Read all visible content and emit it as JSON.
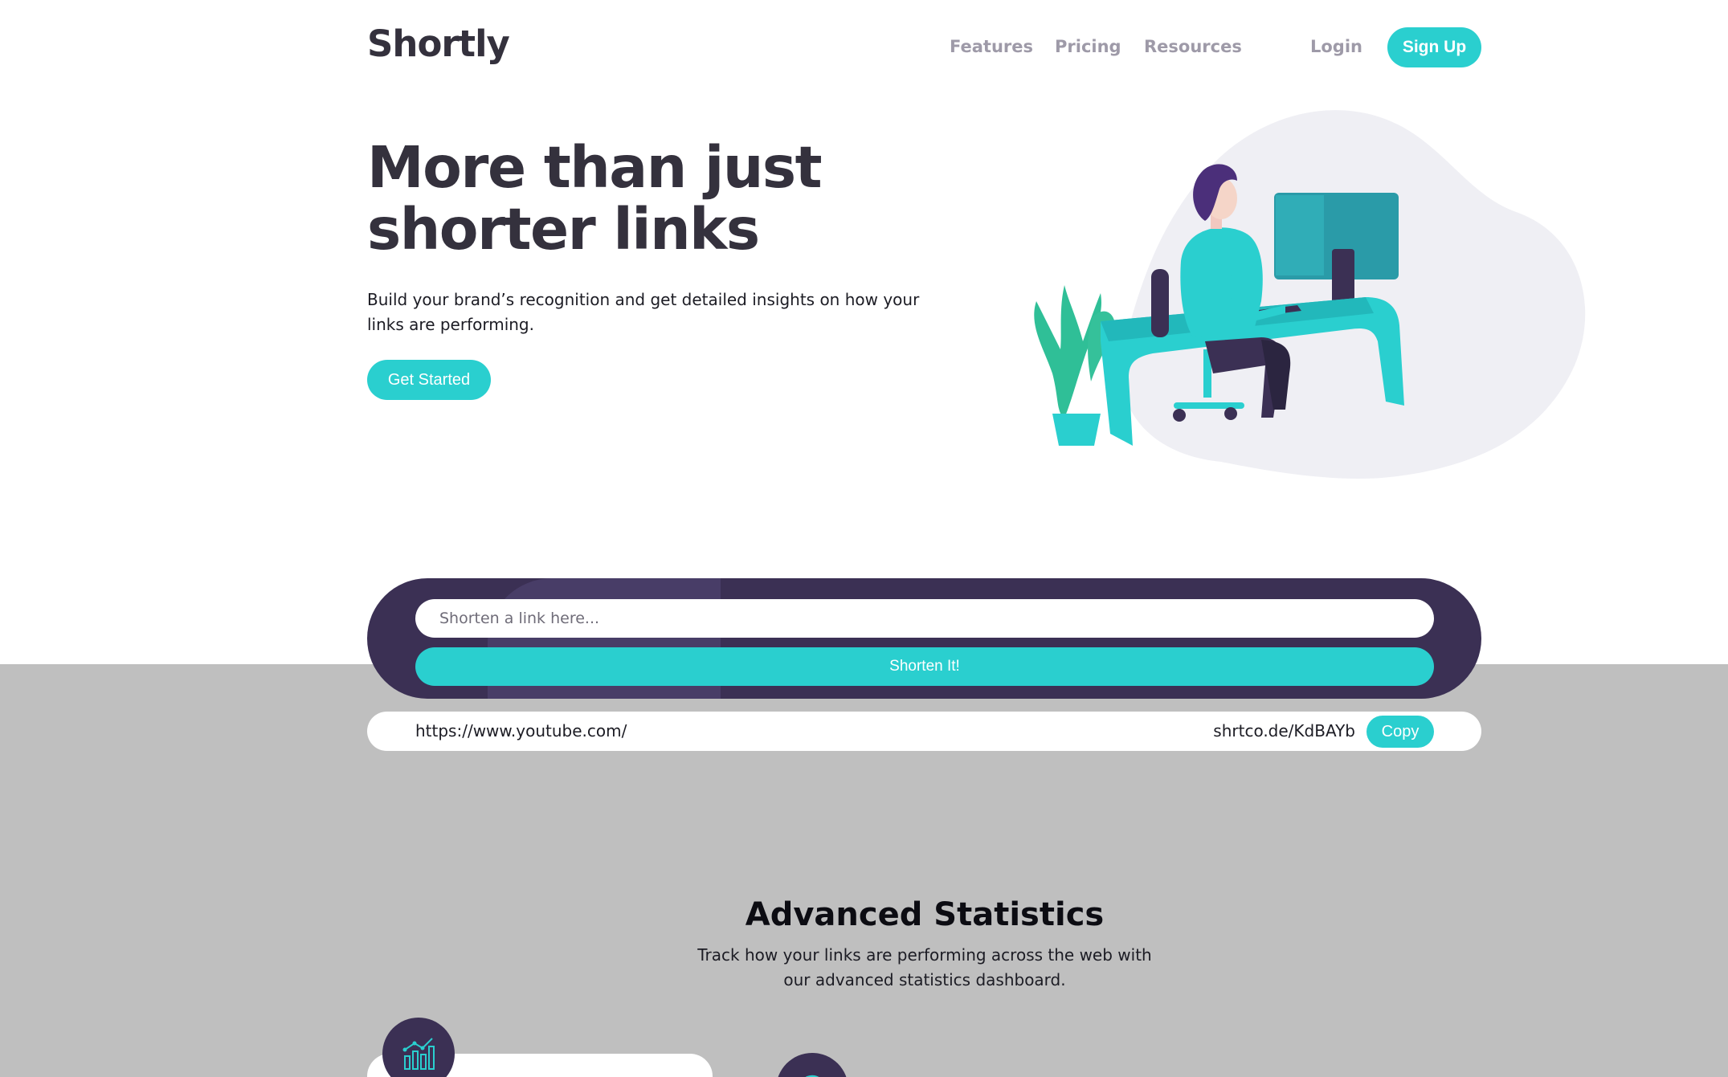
{
  "header": {
    "logo": "Shortly",
    "nav": {
      "features": "Features",
      "pricing": "Pricing",
      "resources": "Resources",
      "login": "Login",
      "signup": "Sign Up"
    }
  },
  "hero": {
    "title": "More than just shorter links",
    "subtitle": "Build your brand’s recognition and get detailed insights on how your links are performing.",
    "cta": "Get Started"
  },
  "shorten": {
    "placeholder": "Shorten a link here...",
    "button": "Shorten It!"
  },
  "results": [
    {
      "original": "https://www.youtube.com/",
      "short": "shrtco.de/KdBAYb",
      "copy": "Copy"
    }
  ],
  "statistics": {
    "title": "Advanced Statistics",
    "subtitle": "Track how your links are performing across the web with our advanced statistics dashboard.",
    "icons": [
      "chart-icon",
      "speedometer-icon"
    ]
  },
  "colors": {
    "accent": "#2acfcf",
    "dark_violet": "#3b3054",
    "gray_band": "#bfbfbf"
  }
}
